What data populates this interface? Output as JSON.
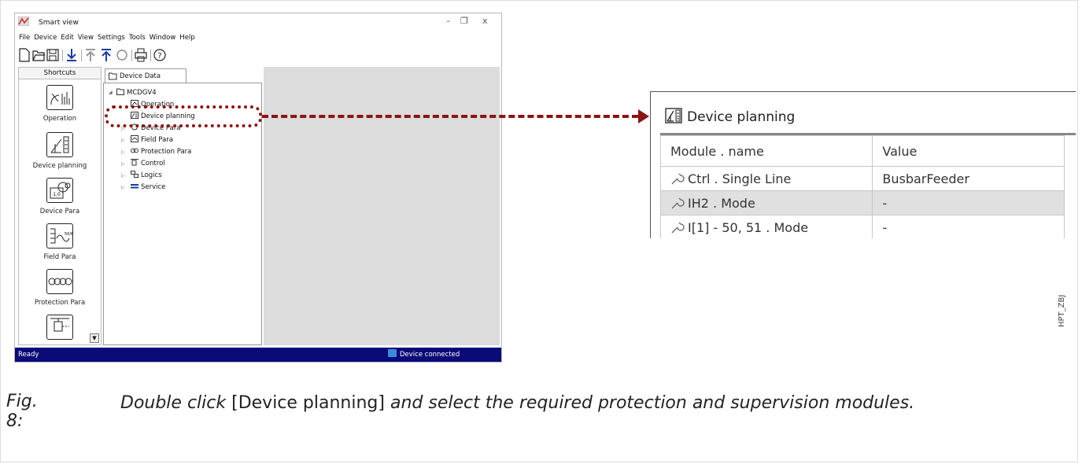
{
  "app": {
    "title": "Smart view",
    "menu": [
      "File",
      "Device",
      "Edit",
      "View",
      "Settings",
      "Tools",
      "Window",
      "Help"
    ],
    "shortcuts_header": "Shortcuts",
    "shortcuts": [
      "Operation",
      "Device planning",
      "Device Para",
      "Field Para",
      "Protection Para"
    ],
    "tab_label": "Device Data",
    "tree": {
      "root": "MCDGV4",
      "items": [
        "Operation",
        "Device planning",
        "Device Para",
        "Field Para",
        "Protection Para",
        "Control",
        "Logics",
        "Service"
      ]
    },
    "status_left": "Ready",
    "status_right": "Device connected"
  },
  "zoom_panel": {
    "title": "Device planning",
    "columns": [
      "Module . name",
      "Value"
    ],
    "rows": [
      {
        "name": "Ctrl . Single Line",
        "value": "BusbarFeeder"
      },
      {
        "name": "IH2 . Mode",
        "value": "-"
      },
      {
        "name": "I[1] - 50, 51 . Mode",
        "value": "-"
      }
    ]
  },
  "side_tag": "HPT_ZBJ",
  "caption": {
    "number": "Fig. 8:",
    "lead": "Double click",
    "bracket": "[Device planning]",
    "rest": "and select the required protection and supervision modules."
  },
  "colors": {
    "status_bar": "#0a0a78",
    "highlight": "#8b1414"
  }
}
